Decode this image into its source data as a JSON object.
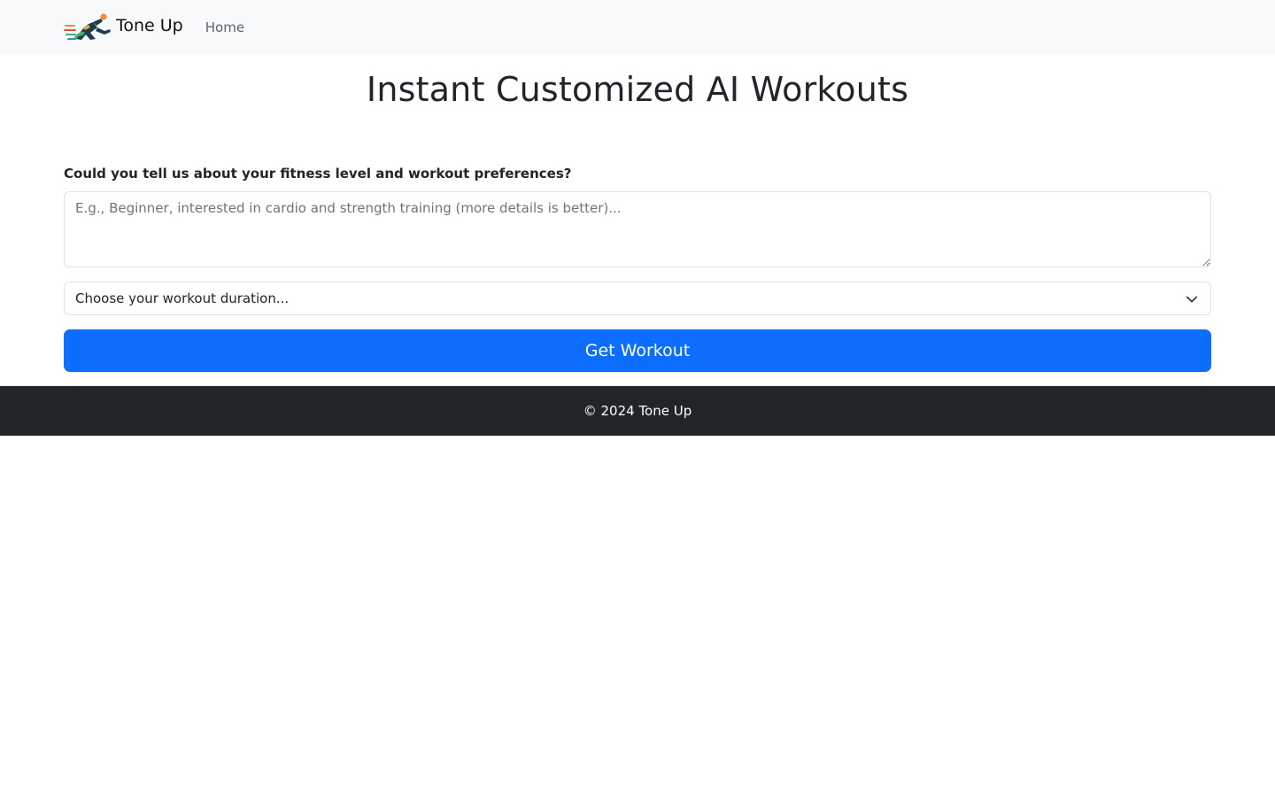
{
  "nav": {
    "brand_name": "Tone Up",
    "links": [
      {
        "label": "Home"
      }
    ],
    "logo_icon": "runner-logo-icon"
  },
  "main": {
    "title": "Instant Customized AI Workouts",
    "form": {
      "question_label": "Could you tell us about your fitness level and workout preferences?",
      "prefs_value": "",
      "prefs_placeholder": "E.g., Beginner, interested in cardio and strength training (more details is better)...",
      "duration_selected": "Choose your workout duration...",
      "submit_label": "Get Workout"
    }
  },
  "footer": {
    "text": "© 2024 Tone Up"
  },
  "colors": {
    "navbar_bg": "#f8f9fa",
    "primary": "#0d6efd",
    "footer_bg": "#212529",
    "text": "#212529"
  }
}
